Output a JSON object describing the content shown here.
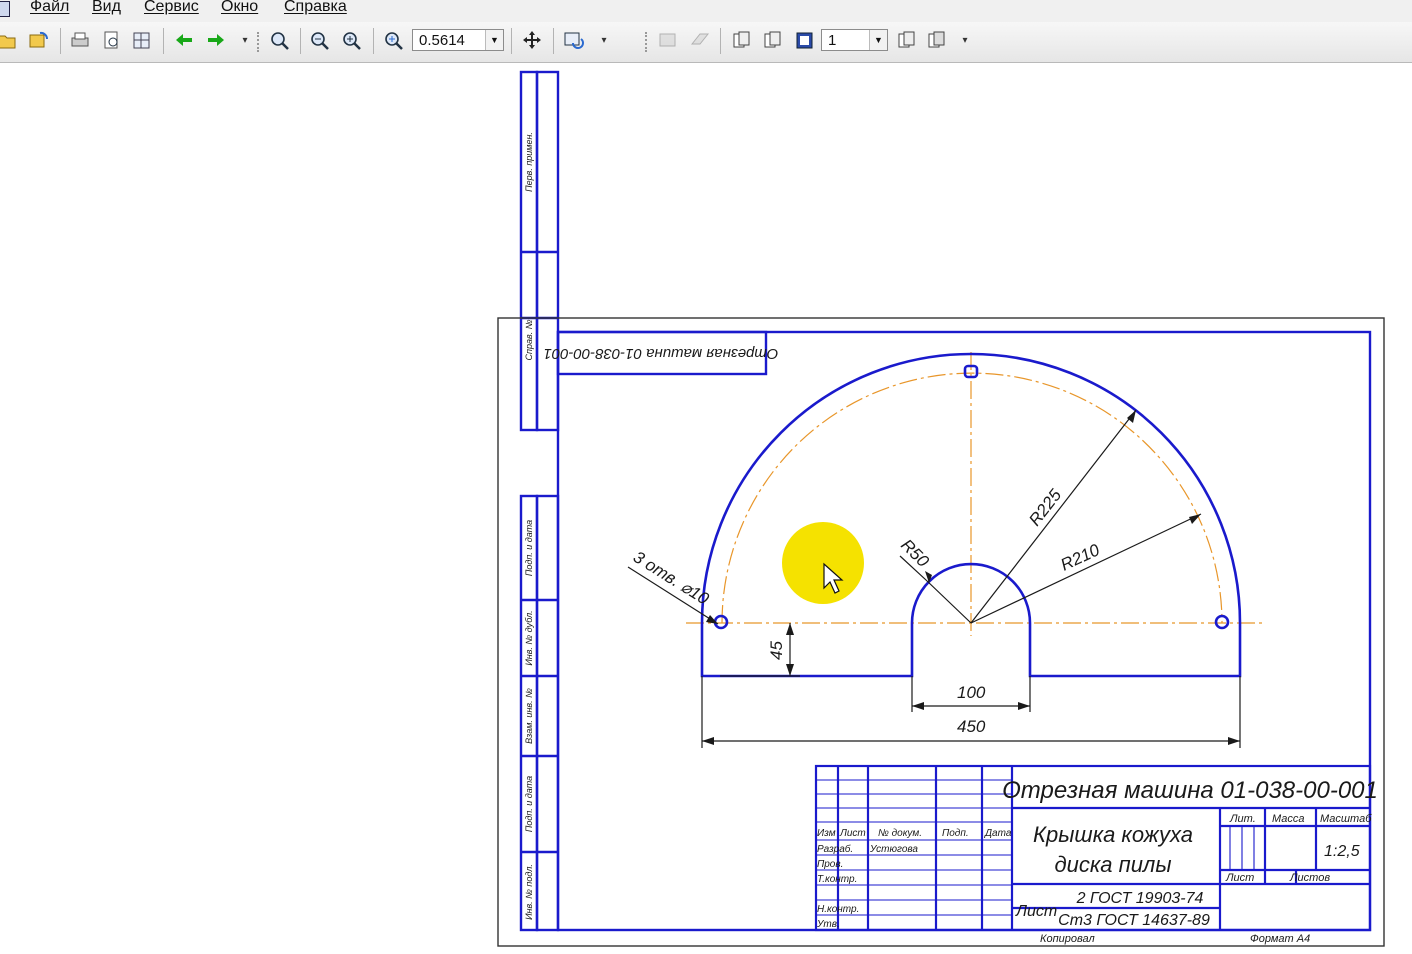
{
  "menu": {
    "items": [
      "Файл",
      "Вид",
      "Сервис",
      "Окно",
      "Справка"
    ]
  },
  "toolbar": {
    "zoom_value": "0.5614",
    "page_value": "1",
    "icons": [
      "open-icon",
      "refresh-icon",
      "print-icon",
      "print-preview-icon",
      "layout-icon",
      "back-arrow-icon",
      "forward-arrow-icon",
      "zoom-window-icon",
      "zoom-out-icon",
      "zoom-in-icon",
      "zoom-icon",
      "pan-icon",
      "redraw-icon",
      "view-icon",
      "page-icon"
    ]
  },
  "colors": {
    "frame_line": "#1a1acc",
    "axis_line": "#e8962a",
    "cursor_highlight": "#f5e200",
    "green_arrows": "#18a818"
  },
  "drawing": {
    "stamp_top_text": "Отрезная машина  01-038-00-001",
    "side_stamp": [
      "Перв. примен.",
      "Справ. №",
      "Подп. и дата",
      "Инв. № дубл.",
      "Взам. инв. №",
      "Подп. и дата",
      "Инв. № подл."
    ],
    "dimensions": {
      "holes": "3 отв. ⌀10",
      "r50": "R50",
      "r225": "R225",
      "r210": "R210",
      "d45": "45",
      "d100": "100",
      "d450": "450"
    },
    "title_block": {
      "designation": "Отрезная машина  01-038-00-001",
      "part_name_1": "Крышка кожуха",
      "part_name_2": "диска пилы",
      "material_1": "2 ГОСТ 19903-74",
      "material_2": "Ст3 ГОСТ 14637-89",
      "material_prefix": "Лист",
      "lit": "Лит.",
      "mass": "Масса",
      "scale_label": "Масштаб",
      "scale": "1:2,5",
      "sheet": "Лист",
      "sheets": "Листов",
      "row_labels": [
        "Изм",
        "Лист",
        "№ докум.",
        "Подп.",
        "Дата"
      ],
      "roles": [
        "Разраб.",
        "Пров.",
        "Т.контр.",
        "",
        "Н.контр.",
        "Утв."
      ],
      "developer": "Устюгова",
      "copied": "Копировал",
      "format": "Формат   А4"
    }
  }
}
